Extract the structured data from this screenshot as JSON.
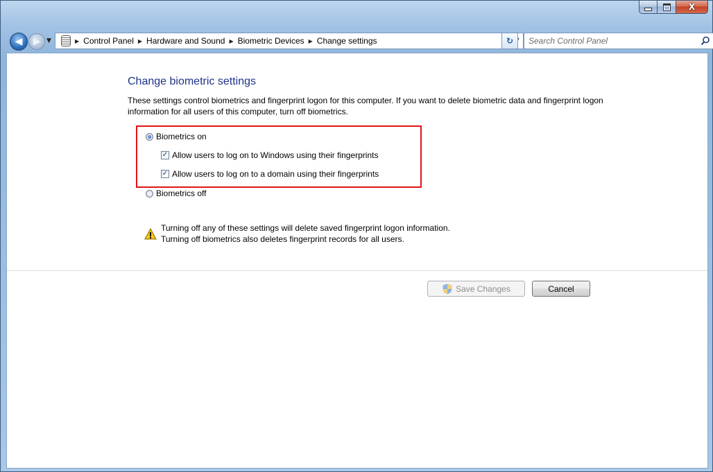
{
  "window": {
    "caption": {
      "minimize": "–",
      "maximize": "□",
      "close": "X"
    }
  },
  "navigation": {
    "breadcrumbs": [
      "Control Panel",
      "Hardware and Sound",
      "Biometric Devices",
      "Change settings"
    ],
    "search_placeholder": "Search Control Panel",
    "icons": {
      "back": "back-arrow-icon",
      "forward": "forward-arrow-icon",
      "recent": "chevron-down-icon",
      "address": "fingerprint-icon",
      "refresh": "refresh-icon",
      "search": "search-icon"
    }
  },
  "page": {
    "title": "Change biometric settings",
    "description": "These settings control biometrics and fingerprint logon for this computer. If you want to delete biometric data and fingerprint logon information for all users of this computer, turn off biometrics.",
    "options": {
      "biometrics_on": {
        "label": "Biometrics on",
        "selected": true
      },
      "allow_windows_logon": {
        "label": "Allow users to log on to Windows using their fingerprints",
        "checked": true
      },
      "allow_domain_logon": {
        "label": "Allow users to log on to a domain using their fingerprints",
        "checked": true
      },
      "biometrics_off": {
        "label": "Biometrics off",
        "selected": false
      }
    },
    "warning": {
      "line1": "Turning off any of these settings will delete saved fingerprint logon information.",
      "line2": "Turning off biometrics also deletes fingerprint records for all users."
    },
    "buttons": {
      "save": "Save Changes",
      "cancel": "Cancel"
    }
  },
  "colors": {
    "title": "#1e3287",
    "highlight_border": "#e01414"
  }
}
